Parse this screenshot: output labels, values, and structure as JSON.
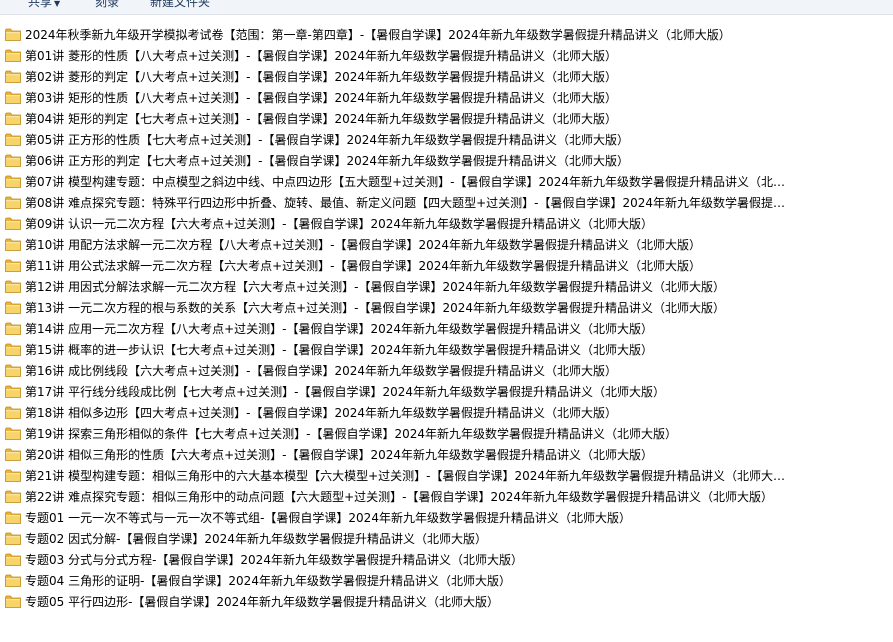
{
  "toolbar": {
    "share_label": "共享",
    "burn_label": "刻录",
    "new_folder_label": "新建文件夹"
  },
  "items": [
    "2024年秋季新九年级开学模拟考试卷【范围：第一章-第四章】-【暑假自学课】2024年新九年级数学暑假提升精品讲义（北师大版）",
    "第01讲 菱形的性质【八大考点+过关测】-【暑假自学课】2024年新九年级数学暑假提升精品讲义（北师大版）",
    "第02讲 菱形的判定【八大考点+过关测】-【暑假自学课】2024年新九年级数学暑假提升精品讲义（北师大版）",
    "第03讲 矩形的性质【八大考点+过关测】-【暑假自学课】2024年新九年级数学暑假提升精品讲义（北师大版）",
    "第04讲 矩形的判定【七大考点+过关测】-【暑假自学课】2024年新九年级数学暑假提升精品讲义（北师大版）",
    "第05讲 正方形的性质【七大考点+过关测】-【暑假自学课】2024年新九年级数学暑假提升精品讲义（北师大版）",
    "第06讲 正方形的判定【七大考点+过关测】-【暑假自学课】2024年新九年级数学暑假提升精品讲义（北师大版）",
    "第07讲 模型构建专题：中点模型之斜边中线、中点四边形【五大题型+过关测】-【暑假自学课】2024年新九年级数学暑假提升精品讲义（北师...",
    "第08讲 难点探究专题：特殊平行四边形中折叠、旋转、最值、新定义问题【四大题型+过关测】-【暑假自学课】2024年新九年级数学暑假提升...",
    "第09讲 认识一元二次方程【六大考点+过关测】-【暑假自学课】2024年新九年级数学暑假提升精品讲义（北师大版）",
    "第10讲 用配方法求解一元二次方程【八大考点+过关测】-【暑假自学课】2024年新九年级数学暑假提升精品讲义（北师大版）",
    "第11讲 用公式法求解一元二次方程【六大考点+过关测】-【暑假自学课】2024年新九年级数学暑假提升精品讲义（北师大版）",
    "第12讲 用因式分解法求解一元二次方程【六大考点+过关测】-【暑假自学课】2024年新九年级数学暑假提升精品讲义（北师大版）",
    "第13讲 一元二次方程的根与系数的关系【六大考点+过关测】-【暑假自学课】2024年新九年级数学暑假提升精品讲义（北师大版）",
    "第14讲 应用一元二次方程【八大考点+过关测】-【暑假自学课】2024年新九年级数学暑假提升精品讲义（北师大版）",
    "第15讲 概率的进一步认识【七大考点+过关测】-【暑假自学课】2024年新九年级数学暑假提升精品讲义（北师大版）",
    "第16讲 成比例线段【六大考点+过关测】-【暑假自学课】2024年新九年级数学暑假提升精品讲义（北师大版）",
    "第17讲 平行线分线段成比例【七大考点+过关测】-【暑假自学课】2024年新九年级数学暑假提升精品讲义（北师大版）",
    "第18讲 相似多边形【四大考点+过关测】-【暑假自学课】2024年新九年级数学暑假提升精品讲义（北师大版）",
    "第19讲 探索三角形相似的条件【七大考点+过关测】-【暑假自学课】2024年新九年级数学暑假提升精品讲义（北师大版）",
    "第20讲 相似三角形的性质【六大考点+过关测】-【暑假自学课】2024年新九年级数学暑假提升精品讲义（北师大版）",
    "第21讲 模型构建专题：相似三角形中的六大基本模型【六大模型+过关测】-【暑假自学课】2024年新九年级数学暑假提升精品讲义（北师大版）",
    "第22讲 难点探究专题：相似三角形中的动点问题【六大题型+过关测】-【暑假自学课】2024年新九年级数学暑假提升精品讲义（北师大版）",
    "专题01 一元一次不等式与一元一次不等式组-【暑假自学课】2024年新九年级数学暑假提升精品讲义（北师大版）",
    "专题02 因式分解-【暑假自学课】2024年新九年级数学暑假提升精品讲义（北师大版）",
    "专题03 分式与分式方程-【暑假自学课】2024年新九年级数学暑假提升精品讲义（北师大版）",
    "专题04 三角形的证明-【暑假自学课】2024年新九年级数学暑假提升精品讲义（北师大版）",
    "专题05 平行四边形-【暑假自学课】2024年新九年级数学暑假提升精品讲义（北师大版）"
  ]
}
